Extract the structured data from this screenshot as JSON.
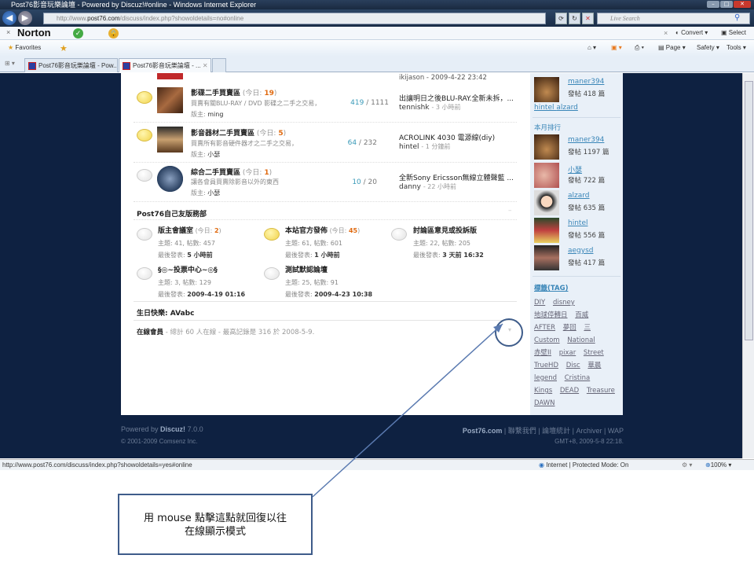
{
  "window": {
    "title": "Post76影音玩樂論壇 - Powered by Discuz!#online - Windows Internet Explorer"
  },
  "address": {
    "url_prefix": "http://www.",
    "url_domain": "post76.com",
    "url_path": "/discuss/index.php?showoldetails=no#online",
    "search_placeholder": "Live Search"
  },
  "norton": {
    "label": "Norton",
    "convert": "Convert",
    "select": "Select"
  },
  "favorites": {
    "label": "Favorites",
    "page": "Page",
    "safety": "Safety",
    "tools": "Tools"
  },
  "tabs": [
    {
      "label": "Post76影音玩樂論壇 - Pow..."
    },
    {
      "label": "Post76影音玩樂論壇 - ..."
    }
  ],
  "forums": {
    "top_partial": "ikijason - 2009-4-22 23:42",
    "rows": [
      {
        "name": "影碟二手買賣區",
        "today_label": "(今日:",
        "today": "19",
        "desc": "買賣有關BLU-RAY / DVD 影碟之二手之交易，",
        "mod_label": "版主:",
        "mod": "ming",
        "topics": "419",
        "posts": "1111",
        "last_title": "出讓明日之後BLU-RAY.全新未拆，...",
        "last_user": "tennishk",
        "last_time": "- 3 小時前"
      },
      {
        "name": "影音器材二手買賣區",
        "today_label": "(今日:",
        "today": "5",
        "desc": "買賣所有影音硬件器才之二手之交易，",
        "mod_label": "版主:",
        "mod": "小瑟",
        "topics": "64",
        "posts": "232",
        "last_title": "ACROLINK 4030 電源線(diy)",
        "last_user": "hintel",
        "last_time": "- 1 分鐘前"
      },
      {
        "name": "綜合二手買賣區",
        "today_label": "(今日:",
        "today": "1",
        "desc": "讓各會員買賣除影音以外的東西",
        "mod_label": "版主:",
        "mod": "小瑟",
        "topics": "10",
        "posts": "20",
        "last_title": "全新Sony Ericsson無線立體聲藍 ...",
        "last_user": "danny",
        "last_time": "- 22 小時前"
      }
    ]
  },
  "club": {
    "title": "Post76自己友版務部",
    "cells": [
      {
        "name": "版主會議室",
        "today": "2",
        "stats": "主題: 41, 帖數: 457",
        "last_label": "最後發表:",
        "last": "5 小時前",
        "hot": false
      },
      {
        "name": "本站官方發佈",
        "today": "45",
        "stats": "主題: 61, 帖數: 601",
        "last_label": "最後發表:",
        "last": "1 小時前",
        "hot": true
      },
      {
        "name": "討論區意見或投訴版",
        "today": "",
        "stats": "主題: 22, 帖數: 205",
        "last_label": "最後發表:",
        "last": "3 天前 16:32",
        "hot": false
      },
      {
        "name": "§◎~投票中心~◎§",
        "today": "",
        "stats": "主題: 3, 帖數: 129",
        "last_label": "最後發表:",
        "last": "2009-4-19 01:16",
        "hot": false
      },
      {
        "name": "測試默認論壇",
        "today": "",
        "stats": "主題: 25, 帖數: 91",
        "last_label": "最後發表:",
        "last": "2009-4-23 10:38",
        "hot": false
      }
    ],
    "today_label": "(今日:"
  },
  "birthday": {
    "label": "生日快樂:",
    "name": "AVabc"
  },
  "online": {
    "label": "在線會員",
    "text": "- 總計 60 人在線 - 最高記錄是 316 於 2008-5-9."
  },
  "sidebar": {
    "top_user": {
      "name": "maner394",
      "posts": "發帖 418 篇"
    },
    "extra_links": [
      "hintel",
      "alzard"
    ],
    "monthly_title": "本月排行",
    "monthly": [
      {
        "name": "maner394",
        "posts": "發帖 1197 篇"
      },
      {
        "name": "小瑟",
        "posts": "發帖 722 篇"
      },
      {
        "name": "alzard",
        "posts": "發帖 635 篇"
      },
      {
        "name": "hintel",
        "posts": "發帖 556 篇"
      },
      {
        "name": "aegysd",
        "posts": "發帖 417 篇"
      }
    ],
    "tags_title": "標籤(TAG)",
    "tags": [
      "DIY",
      "disney",
      "地球停轉日",
      "百威",
      "AFTER",
      "夢回",
      "三",
      "Custom",
      "National",
      "赤壁II",
      "pixar",
      "Street",
      "TrueHD",
      "Disc",
      "華晨",
      "legend",
      "Cristina",
      "Kings",
      "DEAD",
      "Treasure",
      "DAWN"
    ]
  },
  "footer": {
    "powered": "Powered by",
    "brand": "Discuz!",
    "version": "7.0.0",
    "copyright": "© 2001-2009 Comsenz Inc.",
    "site": "Post76.com",
    "links": [
      "聯繫我們",
      "論壇統計",
      "Archiver",
      "WAP"
    ],
    "time": "GMT+8, 2009-5-8 22:18."
  },
  "status": {
    "url": "http://www.post76.com/discuss/index.php?showoldetails=yes#online",
    "zone": "Internet | Protected Mode: On",
    "zoom": "100%"
  },
  "annotation": {
    "line1": "用 mouse 點擊這點就回復以往",
    "line2": "在線顯示模式",
    "color": "#3e5c8a"
  }
}
